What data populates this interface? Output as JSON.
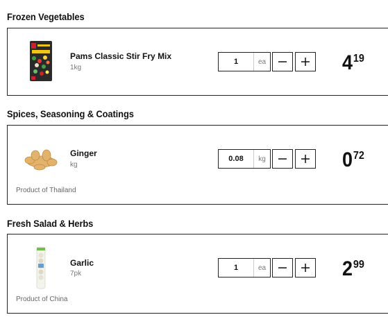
{
  "sections": [
    {
      "title": "Frozen Vegetables",
      "item": {
        "name": "Pams Classic Stir Fry Mix",
        "unit": "1kg",
        "origin": "",
        "qty": "1",
        "qty_unit": "ea",
        "price_dollars": "4",
        "price_cents": "19",
        "image_icon": "frozen-veg-bag"
      }
    },
    {
      "title": "Spices, Seasoning & Coatings",
      "item": {
        "name": "Ginger",
        "unit": "kg",
        "origin": "Product of Thailand",
        "qty": "0.08",
        "qty_unit": "kg",
        "price_dollars": "0",
        "price_cents": "72",
        "image_icon": "ginger-root"
      }
    },
    {
      "title": "Fresh Salad & Herbs",
      "item": {
        "name": "Garlic",
        "unit": "7pk",
        "origin": "Product of China",
        "qty": "1",
        "qty_unit": "ea",
        "price_dollars": "2",
        "price_cents": "99",
        "image_icon": "garlic-pack"
      }
    }
  ],
  "controls": {
    "minus_icon": "minus-icon",
    "plus_icon": "plus-icon"
  }
}
